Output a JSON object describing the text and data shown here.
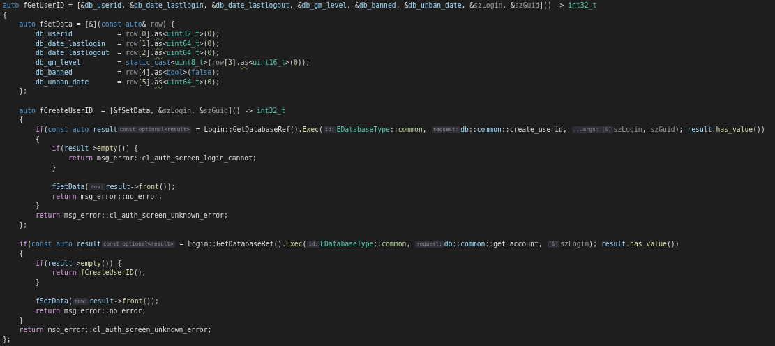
{
  "editor": {
    "blocks": [
      {
        "lines": [
          {
            "tokens": [
              {
                "kind": "kw",
                "text": "auto"
              },
              {
                "kind": "plain",
                "text": " fGetUserID = [&"
              },
              {
                "kind": "var",
                "text": "db_userid"
              },
              {
                "kind": "plain",
                "text": ", &"
              },
              {
                "kind": "var",
                "text": "db_date_lastlogin"
              },
              {
                "kind": "plain",
                "text": ", &"
              },
              {
                "kind": "var",
                "text": "db_date_lastlogout"
              },
              {
                "kind": "plain",
                "text": ", &"
              },
              {
                "kind": "var",
                "text": "db_gm_level"
              },
              {
                "kind": "plain",
                "text": ", &"
              },
              {
                "kind": "var",
                "text": "db_banned"
              },
              {
                "kind": "plain",
                "text": ", &"
              },
              {
                "kind": "var",
                "text": "db_unban_date"
              },
              {
                "kind": "plain",
                "text": ", &"
              },
              {
                "kind": "param",
                "text": "szLogin"
              },
              {
                "kind": "plain",
                "text": ", &"
              },
              {
                "kind": "param",
                "text": "szGuid"
              },
              {
                "kind": "plain",
                "text": "]() -> "
              },
              {
                "kind": "type",
                "text": "int32_t"
              }
            ]
          },
          {
            "tokens": [
              {
                "kind": "plain",
                "text": "{"
              }
            ]
          },
          {
            "tokens": [
              {
                "kind": "kw",
                "text": "    auto"
              },
              {
                "kind": "plain",
                "text": " fSetData = [&]("
              },
              {
                "kind": "kw",
                "text": "const auto"
              },
              {
                "kind": "plain",
                "text": "& "
              },
              {
                "kind": "param",
                "text": "row"
              },
              {
                "kind": "plain",
                "text": ") {"
              }
            ]
          },
          {
            "tokens": [
              {
                "kind": "var",
                "text": "        db_userid"
              },
              {
                "kind": "plain",
                "text": "           = "
              },
              {
                "kind": "param",
                "text": "row"
              },
              {
                "kind": "plain",
                "text": "["
              },
              {
                "kind": "num",
                "text": "0"
              },
              {
                "kind": "plain",
                "text": "]."
              },
              {
                "kind": "warn",
                "text": "as"
              },
              {
                "kind": "plain",
                "text": "<"
              },
              {
                "kind": "type",
                "text": "uint32_t"
              },
              {
                "kind": "plain",
                "text": ">("
              },
              {
                "kind": "num",
                "text": "0"
              },
              {
                "kind": "plain",
                "text": ");"
              }
            ]
          },
          {
            "tokens": [
              {
                "kind": "var",
                "text": "        db_date_lastlogin"
              },
              {
                "kind": "plain",
                "text": "   = "
              },
              {
                "kind": "param",
                "text": "row"
              },
              {
                "kind": "plain",
                "text": "["
              },
              {
                "kind": "num",
                "text": "1"
              },
              {
                "kind": "plain",
                "text": "]."
              },
              {
                "kind": "warn",
                "text": "as"
              },
              {
                "kind": "plain",
                "text": "<"
              },
              {
                "kind": "type",
                "text": "uint64_t"
              },
              {
                "kind": "plain",
                "text": ">("
              },
              {
                "kind": "num",
                "text": "0"
              },
              {
                "kind": "plain",
                "text": ");"
              }
            ]
          },
          {
            "tokens": [
              {
                "kind": "var",
                "text": "        db_date_lastlogout"
              },
              {
                "kind": "plain",
                "text": "  = "
              },
              {
                "kind": "param",
                "text": "row"
              },
              {
                "kind": "plain",
                "text": "["
              },
              {
                "kind": "num",
                "text": "2"
              },
              {
                "kind": "plain",
                "text": "]."
              },
              {
                "kind": "warn",
                "text": "as"
              },
              {
                "kind": "plain",
                "text": "<"
              },
              {
                "kind": "type",
                "text": "uint64_t"
              },
              {
                "kind": "plain",
                "text": ">("
              },
              {
                "kind": "num",
                "text": "0"
              },
              {
                "kind": "plain",
                "text": ");"
              }
            ]
          },
          {
            "tokens": [
              {
                "kind": "var",
                "text": "        db_gm_level"
              },
              {
                "kind": "plain",
                "text": "         = "
              },
              {
                "kind": "kw",
                "text": "static_cast"
              },
              {
                "kind": "plain",
                "text": "<"
              },
              {
                "kind": "type",
                "text": "uint8_t"
              },
              {
                "kind": "plain",
                "text": ">("
              },
              {
                "kind": "param",
                "text": "row"
              },
              {
                "kind": "plain",
                "text": "["
              },
              {
                "kind": "num",
                "text": "3"
              },
              {
                "kind": "plain",
                "text": "]."
              },
              {
                "kind": "warn",
                "text": "as"
              },
              {
                "kind": "plain",
                "text": "<"
              },
              {
                "kind": "type",
                "text": "uint16_t"
              },
              {
                "kind": "plain",
                "text": ">("
              },
              {
                "kind": "num",
                "text": "0"
              },
              {
                "kind": "plain",
                "text": "));"
              }
            ]
          },
          {
            "tokens": [
              {
                "kind": "var",
                "text": "        db_banned"
              },
              {
                "kind": "plain",
                "text": "           = "
              },
              {
                "kind": "param",
                "text": "row"
              },
              {
                "kind": "plain",
                "text": "["
              },
              {
                "kind": "num",
                "text": "4"
              },
              {
                "kind": "plain",
                "text": "]."
              },
              {
                "kind": "warn",
                "text": "as"
              },
              {
                "kind": "plain",
                "text": "<"
              },
              {
                "kind": "kw",
                "text": "bool"
              },
              {
                "kind": "plain",
                "text": ">("
              },
              {
                "kind": "kw",
                "text": "false"
              },
              {
                "kind": "plain",
                "text": ");"
              }
            ]
          },
          {
            "tokens": [
              {
                "kind": "var",
                "text": "        db_unban_date"
              },
              {
                "kind": "plain",
                "text": "       = "
              },
              {
                "kind": "param",
                "text": "row"
              },
              {
                "kind": "plain",
                "text": "["
              },
              {
                "kind": "num",
                "text": "5"
              },
              {
                "kind": "plain",
                "text": "]."
              },
              {
                "kind": "warn",
                "text": "as"
              },
              {
                "kind": "plain",
                "text": "<"
              },
              {
                "kind": "type",
                "text": "uint64_t"
              },
              {
                "kind": "plain",
                "text": ">("
              },
              {
                "kind": "num",
                "text": "0"
              },
              {
                "kind": "plain",
                "text": ");"
              }
            ]
          },
          {
            "tokens": [
              {
                "kind": "plain",
                "text": "    };"
              }
            ]
          }
        ]
      },
      {
        "lines": [
          {
            "tokens": [
              {
                "kind": "kw",
                "text": "    auto"
              },
              {
                "kind": "plain",
                "text": " fCreateUserID  = [&fSetData, &"
              },
              {
                "kind": "param",
                "text": "szLogin"
              },
              {
                "kind": "plain",
                "text": ", &"
              },
              {
                "kind": "param",
                "text": "szGuid"
              },
              {
                "kind": "plain",
                "text": "]() -> "
              },
              {
                "kind": "type",
                "text": "int32_t"
              }
            ]
          },
          {
            "tokens": [
              {
                "kind": "plain",
                "text": "    {"
              }
            ]
          },
          {
            "tokens": [
              {
                "kind": "ctrl",
                "text": "        if"
              },
              {
                "kind": "plain",
                "text": "("
              },
              {
                "kind": "kw",
                "text": "const auto "
              },
              {
                "kind": "var",
                "text": "result"
              },
              {
                "kind": "hint",
                "text": "const optional<result>"
              },
              {
                "kind": "plain",
                "text": " = Login::GetDatabaseRef()."
              },
              {
                "kind": "fn",
                "text": "Exec"
              },
              {
                "kind": "plain",
                "text": "("
              },
              {
                "kind": "hint",
                "text": "id:"
              },
              {
                "kind": "type",
                "text": "EDatabaseType"
              },
              {
                "kind": "plain",
                "text": "::"
              },
              {
                "kind": "enum",
                "text": "common"
              },
              {
                "kind": "plain",
                "text": ", "
              },
              {
                "kind": "hint",
                "text": "request:"
              },
              {
                "kind": "var",
                "text": "db"
              },
              {
                "kind": "plain",
                "text": "::"
              },
              {
                "kind": "var",
                "text": "common"
              },
              {
                "kind": "plain",
                "text": "::create_userid, "
              },
              {
                "kind": "hint",
                "text": "...args: [&]"
              },
              {
                "kind": "param",
                "text": "szLogin"
              },
              {
                "kind": "plain",
                "text": ", "
              },
              {
                "kind": "param",
                "text": "szGuid"
              },
              {
                "kind": "plain",
                "text": "); "
              },
              {
                "kind": "var",
                "text": "result"
              },
              {
                "kind": "plain",
                "text": "."
              },
              {
                "kind": "fn",
                "text": "has_value"
              },
              {
                "kind": "plain",
                "text": "())"
              }
            ]
          },
          {
            "tokens": [
              {
                "kind": "plain",
                "text": "        {"
              }
            ]
          },
          {
            "tokens": [
              {
                "kind": "ctrl",
                "text": "            if"
              },
              {
                "kind": "plain",
                "text": "("
              },
              {
                "kind": "var",
                "text": "result"
              },
              {
                "kind": "plain",
                "text": "->"
              },
              {
                "kind": "fn",
                "text": "empty"
              },
              {
                "kind": "plain",
                "text": "()) {"
              }
            ]
          },
          {
            "tokens": [
              {
                "kind": "ctrl",
                "text": "                return"
              },
              {
                "kind": "plain",
                "text": " msg_error::cl_auth_screen_login_cannot;"
              }
            ]
          },
          {
            "tokens": [
              {
                "kind": "plain",
                "text": "            }"
              }
            ]
          }
        ]
      },
      {
        "lines": [
          {
            "tokens": [
              {
                "kind": "var",
                "text": "            fSetData"
              },
              {
                "kind": "plain",
                "text": "("
              },
              {
                "kind": "hint",
                "text": "row:"
              },
              {
                "kind": "var",
                "text": "result"
              },
              {
                "kind": "plain",
                "text": "->"
              },
              {
                "kind": "fn",
                "text": "front"
              },
              {
                "kind": "plain",
                "text": "());"
              }
            ]
          },
          {
            "tokens": [
              {
                "kind": "ctrl",
                "text": "            return"
              },
              {
                "kind": "plain",
                "text": " msg_error::no_error;"
              }
            ]
          },
          {
            "tokens": [
              {
                "kind": "plain",
                "text": "        }"
              }
            ]
          },
          {
            "tokens": [
              {
                "kind": "ctrl",
                "text": "        return"
              },
              {
                "kind": "plain",
                "text": " msg_error::cl_auth_screen_unknown_error;"
              }
            ]
          },
          {
            "tokens": [
              {
                "kind": "plain",
                "text": "    };"
              }
            ]
          }
        ]
      },
      {
        "lines": [
          {
            "tokens": [
              {
                "kind": "ctrl",
                "text": "    if"
              },
              {
                "kind": "plain",
                "text": "("
              },
              {
                "kind": "kw",
                "text": "const auto "
              },
              {
                "kind": "var",
                "text": "result"
              },
              {
                "kind": "hint",
                "text": "const optional<result>"
              },
              {
                "kind": "plain",
                "text": " = Login::GetDatabaseRef()."
              },
              {
                "kind": "fn",
                "text": "Exec"
              },
              {
                "kind": "plain",
                "text": "("
              },
              {
                "kind": "hint",
                "text": "id:"
              },
              {
                "kind": "type",
                "text": "EDatabaseType"
              },
              {
                "kind": "plain",
                "text": "::"
              },
              {
                "kind": "enum",
                "text": "common"
              },
              {
                "kind": "plain",
                "text": ", "
              },
              {
                "kind": "hint",
                "text": "request:"
              },
              {
                "kind": "var",
                "text": "db"
              },
              {
                "kind": "plain",
                "text": "::"
              },
              {
                "kind": "var",
                "text": "common"
              },
              {
                "kind": "plain",
                "text": "::get_account, "
              },
              {
                "kind": "hint",
                "text": "[&]"
              },
              {
                "kind": "param",
                "text": "szLogin"
              },
              {
                "kind": "plain",
                "text": "); "
              },
              {
                "kind": "var",
                "text": "result"
              },
              {
                "kind": "plain",
                "text": "."
              },
              {
                "kind": "fn",
                "text": "has_value"
              },
              {
                "kind": "plain",
                "text": "())"
              }
            ]
          },
          {
            "tokens": [
              {
                "kind": "plain",
                "text": "    {"
              }
            ]
          },
          {
            "tokens": [
              {
                "kind": "ctrl",
                "text": "        if"
              },
              {
                "kind": "plain",
                "text": "("
              },
              {
                "kind": "var",
                "text": "result"
              },
              {
                "kind": "plain",
                "text": "->"
              },
              {
                "kind": "fn",
                "text": "empty"
              },
              {
                "kind": "plain",
                "text": "()) {"
              }
            ]
          },
          {
            "tokens": [
              {
                "kind": "ctrl",
                "text": "            return "
              },
              {
                "kind": "fn",
                "text": "fCreateUserID"
              },
              {
                "kind": "plain",
                "text": "();"
              }
            ]
          },
          {
            "tokens": [
              {
                "kind": "plain",
                "text": "        }"
              }
            ]
          }
        ]
      },
      {
        "lines": [
          {
            "tokens": [
              {
                "kind": "var",
                "text": "        fSetData"
              },
              {
                "kind": "plain",
                "text": "("
              },
              {
                "kind": "hint",
                "text": "row:"
              },
              {
                "kind": "var",
                "text": "result"
              },
              {
                "kind": "plain",
                "text": "->"
              },
              {
                "kind": "fn",
                "text": "front"
              },
              {
                "kind": "plain",
                "text": "());"
              }
            ]
          },
          {
            "tokens": [
              {
                "kind": "ctrl",
                "text": "        return"
              },
              {
                "kind": "plain",
                "text": " msg_error::no_error;"
              }
            ]
          },
          {
            "tokens": [
              {
                "kind": "plain",
                "text": "    }"
              }
            ]
          },
          {
            "tokens": [
              {
                "kind": "ctrl",
                "text": "    return"
              },
              {
                "kind": "plain",
                "text": " msg_error::cl_auth_screen_unknown_error;"
              }
            ]
          },
          {
            "tokens": [
              {
                "kind": "plain",
                "text": "};"
              }
            ]
          }
        ]
      }
    ]
  }
}
